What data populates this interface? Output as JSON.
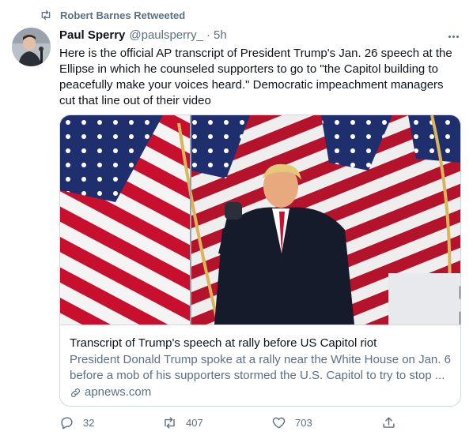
{
  "retweet_banner": {
    "text": "Robert Barnes Retweeted",
    "icon": "retweet-icon"
  },
  "tweet": {
    "author": {
      "display_name": "Paul Sperry",
      "handle": "@paulsperry_",
      "separator": "·",
      "time": "5h"
    },
    "text": "Here is the official AP transcript of President Trump's Jan. 26 speech at the Ellipse in which he counseled supporters to go to \"the Capitol building to peacefully make your voices heard.\" Democratic impeachment managers cut that line out of their video",
    "card": {
      "image_icon": "photo-flags-speaker",
      "title": "Transcript of Trump's speech at rally before US Capitol riot",
      "description": "President Donald Trump spoke at a rally near the White House on Jan. 6 before a mob of his supporters stormed the U.S. Capitol to try to stop ...",
      "domain": "apnews.com",
      "domain_icon": "link-icon"
    },
    "actions": {
      "replies": "32",
      "retweets": "407",
      "likes": "703"
    }
  },
  "colors": {
    "secondary_text": "#5b7083",
    "primary_text": "#0f1419",
    "border": "#cfd9de"
  }
}
